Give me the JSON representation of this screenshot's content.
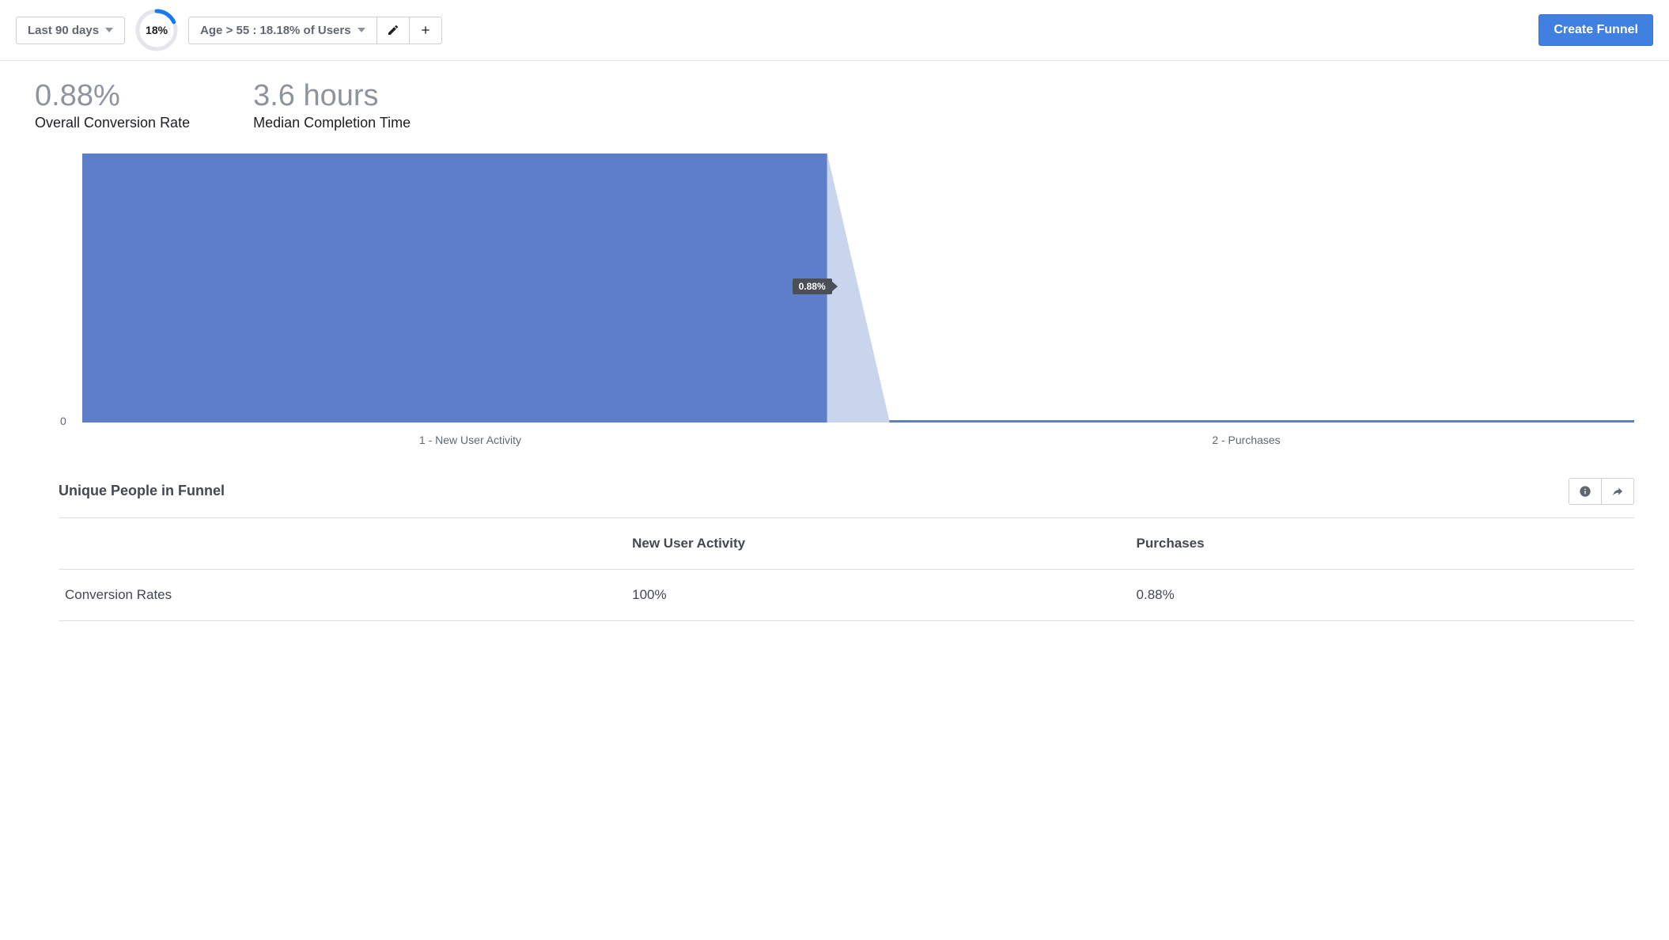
{
  "toolbar": {
    "date_range": "Last 90 days",
    "badge_percent": "18%",
    "badge_value": 18,
    "segment_label": "Age > 55 : 18.18% of Users",
    "create_button": "Create Funnel"
  },
  "metrics": {
    "conversion_value": "0.88%",
    "conversion_label": "Overall Conversion Rate",
    "completion_value": "3.6 hours",
    "completion_label": "Median Completion Time"
  },
  "chart_data": {
    "type": "bar",
    "categories": [
      "1 -    New User Activity",
      "2 - Purchases"
    ],
    "values": [
      100,
      0.88
    ],
    "tooltip": "0.88%",
    "ylabel_zero": "0",
    "ylim": [
      0,
      100
    ]
  },
  "table": {
    "section_title": "Unique People in Funnel",
    "headers": [
      "",
      "New User Activity",
      "Purchases"
    ],
    "rows": [
      {
        "label": "Conversion Rates",
        "values": [
          "100%",
          "0.88%"
        ]
      }
    ]
  }
}
